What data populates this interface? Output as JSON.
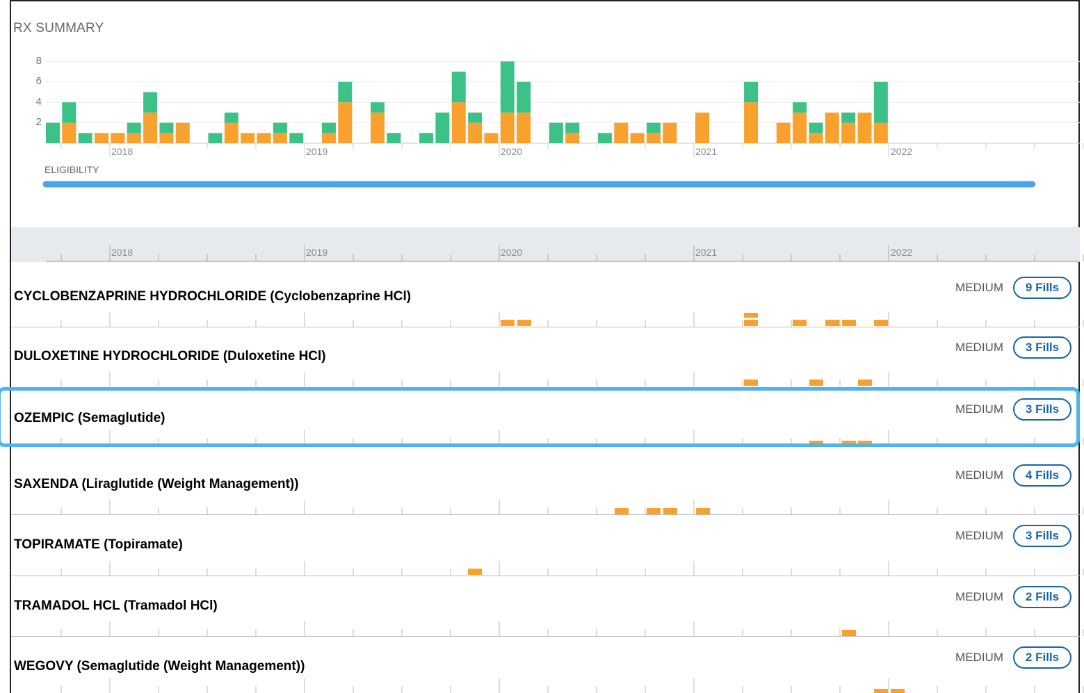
{
  "header": {
    "title": "RX SUMMARY",
    "eligibility_label": "ELIGIBILITY"
  },
  "colors": {
    "green": "#3cc288",
    "orange": "#f9a12e",
    "eligibility": "#4aa3ef",
    "fills_border": "#1565a8",
    "highlight": "#4fb3ef"
  },
  "chart_data": {
    "type": "bar",
    "stacked": true,
    "y_ticks": [
      "2",
      "4",
      "6",
      "8"
    ],
    "ylim": [
      0,
      8
    ],
    "x_years": [
      "2018",
      "2019",
      "2020",
      "2021",
      "2022"
    ],
    "series": [
      {
        "name": "",
        "color": "orange",
        "values": [
          0,
          2,
          0,
          1,
          1,
          1,
          3,
          1,
          2,
          0,
          2,
          1,
          1,
          1,
          0,
          1,
          4,
          3,
          0,
          0,
          0,
          4,
          2,
          1,
          3,
          3,
          0,
          1,
          0,
          2,
          1,
          1,
          2,
          3,
          4,
          2,
          3,
          1,
          3,
          2,
          3,
          2
        ]
      },
      {
        "name": "",
        "color": "green",
        "values": [
          2,
          2,
          1,
          0,
          0,
          1,
          2,
          1,
          0,
          1,
          1,
          0,
          0,
          1,
          1,
          1,
          2,
          1,
          1,
          1,
          3,
          3,
          1,
          0,
          5,
          3,
          2,
          1,
          1,
          0,
          0,
          1,
          0,
          0,
          2,
          0,
          1,
          1,
          0,
          1,
          0,
          4
        ]
      }
    ]
  },
  "eligibility": {
    "segments": [
      {
        "start": "2017-11",
        "end": "2019-04"
      },
      {
        "start": "2019-05",
        "end": "2022-12"
      }
    ]
  },
  "axis_years": [
    "2018",
    "2019",
    "2020",
    "2021",
    "2022"
  ],
  "drugs": [
    {
      "name": "CYCLOBENZAPRINE HYDROCHLORIDE (Cyclobenzaprine HCl)",
      "level": "MEDIUM",
      "fills": "9 Fills"
    },
    {
      "name": "DULOXETINE HYDROCHLORIDE (Duloxetine HCl)",
      "level": "MEDIUM",
      "fills": "3 Fills"
    },
    {
      "name": "OZEMPIC (Semaglutide)",
      "level": "MEDIUM",
      "fills": "3 Fills"
    },
    {
      "name": "SAXENDA (Liraglutide (Weight Management))",
      "level": "MEDIUM",
      "fills": "4 Fills"
    },
    {
      "name": "TOPIRAMATE (Topiramate)",
      "level": "MEDIUM",
      "fills": "3 Fills"
    },
    {
      "name": "TRAMADOL HCL (Tramadol HCl)",
      "level": "MEDIUM",
      "fills": "2 Fills"
    },
    {
      "name": "WEGOVY (Semaglutide (Weight Management))",
      "level": "MEDIUM",
      "fills": "2 Fills"
    }
  ]
}
